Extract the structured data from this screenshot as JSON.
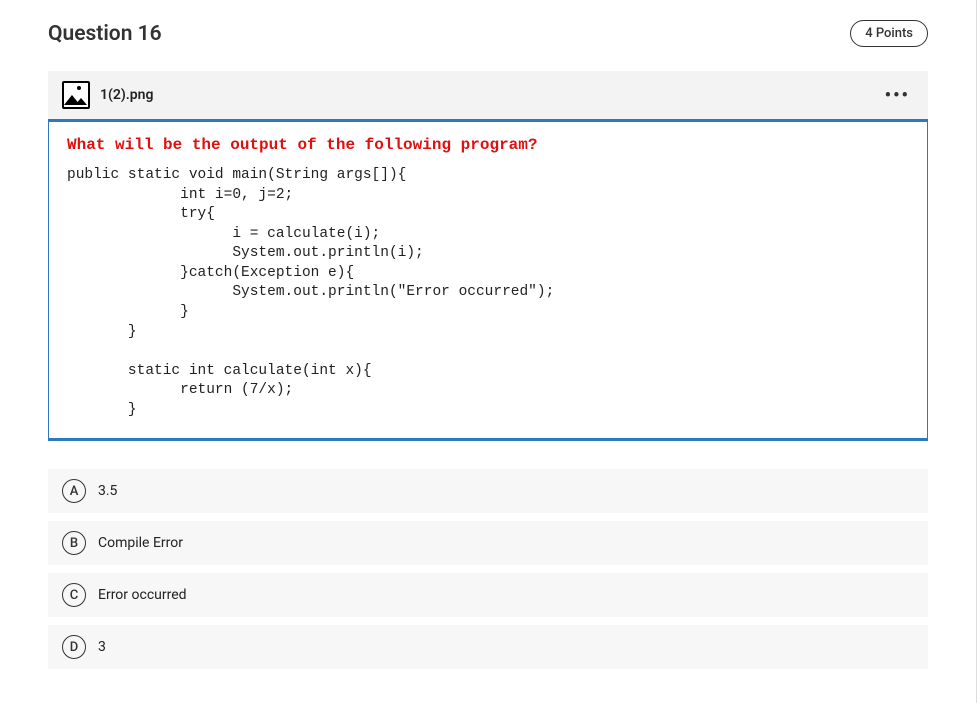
{
  "header": {
    "title": "Question 16",
    "points": "4 Points"
  },
  "file": {
    "name": "1(2).png"
  },
  "question": {
    "prompt": "What will be the output of the following program?",
    "code": "public static void main(String args[]){\n             int i=0, j=2;\n             try{\n                   i = calculate(i);\n                   System.out.println(i);\n             }catch(Exception e){\n                   System.out.println(\"Error occurred\");\n             }\n       }\n\n       static int calculate(int x){\n             return (7/x);\n       }"
  },
  "options": [
    {
      "letter": "A",
      "text": "3.5"
    },
    {
      "letter": "B",
      "text": "Compile Error"
    },
    {
      "letter": "C",
      "text": "Error occurred"
    },
    {
      "letter": "D",
      "text": "3"
    }
  ]
}
